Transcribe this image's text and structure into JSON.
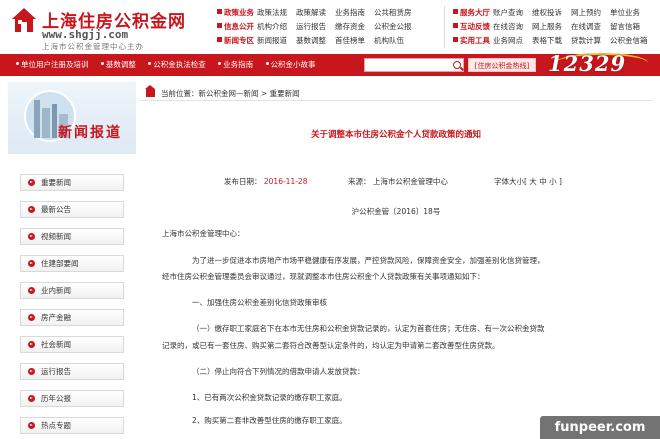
{
  "header": {
    "logo_title": "上海住房公积金网",
    "logo_url": "www.shgjj.com",
    "logo_sub": "上海市公积金管理中心主办",
    "nav_group1": [
      {
        "cat": "政策业务",
        "links": [
          "政策法规",
          "政策解读",
          "业务指南",
          "公共租赁房"
        ]
      },
      {
        "cat": "信息公开",
        "links": [
          "机构介绍",
          "运行报告",
          "缴存资金",
          "公积金公报"
        ]
      },
      {
        "cat": "新闻专区",
        "links": [
          "新闻报道",
          "基数调整",
          "首佳榜单",
          "机构队伍"
        ]
      }
    ],
    "nav_group2": [
      {
        "cat": "服务大厅",
        "links": [
          "账户查询",
          "维权投诉",
          "网上预约",
          "单位业务"
        ]
      },
      {
        "cat": "互动反馈",
        "links": [
          "在线咨询",
          "网上服务",
          "在线调查",
          "留言信箱"
        ]
      },
      {
        "cat": "实用工具",
        "links": [
          "业务网点",
          "表格下载",
          "贷款计算",
          "公积金信箱"
        ]
      }
    ]
  },
  "redbar": {
    "links": [
      "单位用户注册及培训",
      "基数调整",
      "公积金执法检查",
      "业务指南",
      "公积金小故事"
    ],
    "search_btn": "[住房公积金热线]",
    "hotline": "12329"
  },
  "sidebar": {
    "title": "新闻报道",
    "items": [
      "重要新闻",
      "最新公告",
      "视频新闻",
      "住建部要闻",
      "业内新闻",
      "房产金融",
      "社会新闻",
      "运行报告",
      "历年公报",
      "热点专题"
    ]
  },
  "breadcrumb": {
    "prefix": "当前位置：",
    "path": "新公积金网—新闻",
    "sep": ">",
    "current": "重要新闻"
  },
  "article": {
    "title": "关于调整本市住房公积金个人贷款政策的通知",
    "date_label": "发布日期：",
    "date": "2016-11-28",
    "source_label": "来源：",
    "source": "上海市公积金管理中心",
    "font_label": "字体大小[ 大 中 小 ]",
    "doc_no": "沪公积金管〔2016〕18号",
    "paragraphs": [
      "上海市公积金管理中心：",
      "为了进一步促进本市房地产市场平稳健康有序发展，严控贷款风险，保障资金安全，加强差别化信贷管理，",
      "经市住房公积金管理委员会审议通过，现就调整本市住房公积金个人贷款政策有关事项通知如下：",
      "一、加强住房公积金差别化信贷政策审核",
      "（一）缴存职工家庭名下在本市无住房和公积金贷款记录的，认定为首套住房；无住房、有一次公积金贷款",
      "记录的，或已有一套住房、购买第二套符合改善型认定条件的，均认定为申请第二套改善型住房贷款。",
      "（二）停止向符合下列情况的借款申请人发放贷款：",
      "1、已有两次公积金贷款记录的缴存职工家庭。",
      "2、购买第二套非改善型住房的缴存职工家庭。"
    ]
  },
  "watermark": "funpeer.com"
}
